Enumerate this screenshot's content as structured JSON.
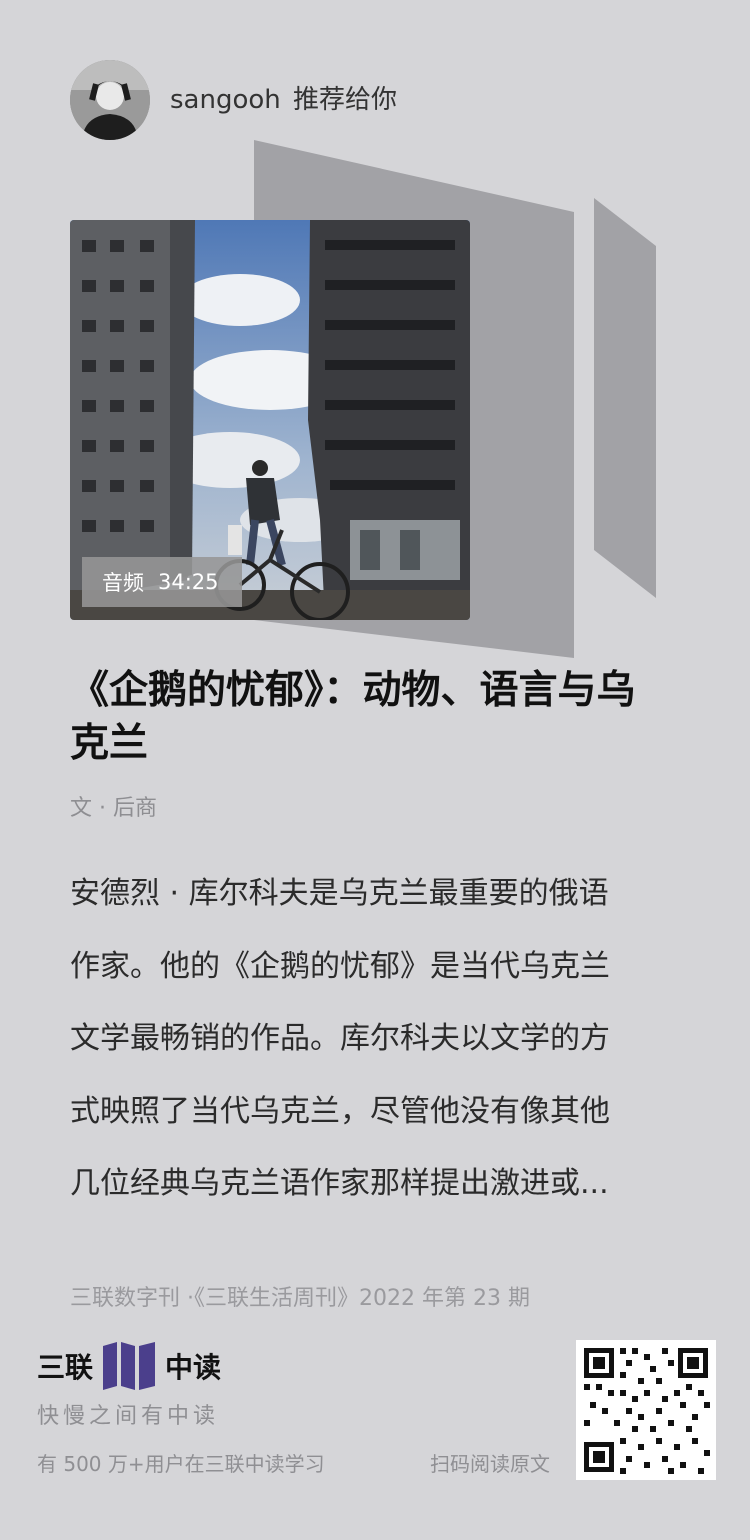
{
  "header": {
    "username": "sangooh",
    "action_text": "推荐给你"
  },
  "cover": {
    "audio_label": "音频",
    "audio_duration": "34:25"
  },
  "article": {
    "title": "《企鹅的忧郁》：动物、语言与乌克兰",
    "author_line": "文 · 后商",
    "summary_lines": [
      "安德烈 · 库尔科夫是乌克兰最重要的俄语",
      "作家。他的《企鹅的忧郁》是当代乌克兰",
      "文学最畅销的作品。库尔科夫以文学的方",
      "式映照了当代乌克兰，尽管他没有像其他",
      "几位经典乌克兰语作家那样提出激进或..."
    ],
    "source": "三联数字刊 ·《三联生活周刊》2022 年第 23 期"
  },
  "footer": {
    "brand_left": "三联",
    "brand_right": "中读",
    "tagline": "快慢之间有中读",
    "users_text": "有 500 万+用户在三联中读学习",
    "scan_text": "扫码阅读原文"
  },
  "colors": {
    "background": "#d5d5d8",
    "brand_purple": "#4b3f8c",
    "deco_gray": "#a3a3a7"
  }
}
